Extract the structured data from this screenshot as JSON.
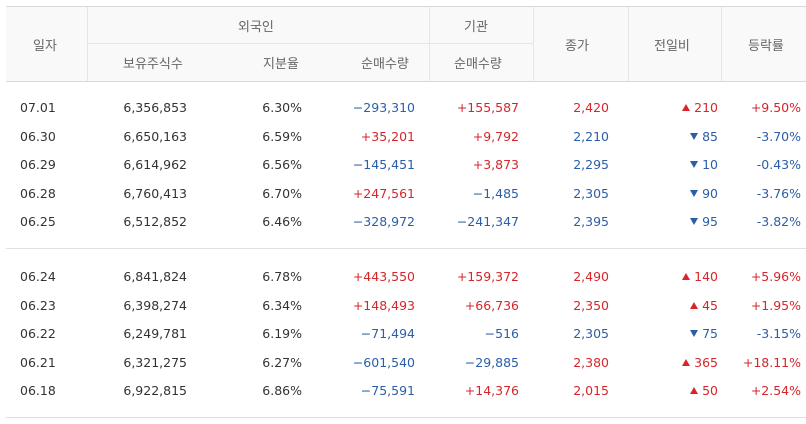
{
  "header": {
    "date": "일자",
    "foreign": "외국인",
    "institution": "기관",
    "close": "종가",
    "change": "전일비",
    "rate": "등락률",
    "holdings": "보유주식수",
    "share_ratio": "지분율",
    "foreign_net": "순매수량",
    "inst_net": "순매수량"
  },
  "colors": {
    "up": "#d6262b",
    "down": "#2b5ea8"
  },
  "groups": [
    {
      "rows": [
        {
          "date": "07.01",
          "holdings": "6,356,853",
          "ratio": "6.30%",
          "foreign_net": "−293,310",
          "fdir": "down",
          "inst_net": "+155,587",
          "idir": "up",
          "close": "2,420",
          "cdir": "up",
          "change": "210",
          "chdir": "up",
          "rate": "+9.50%",
          "rdir": "up"
        },
        {
          "date": "06.30",
          "holdings": "6,650,163",
          "ratio": "6.59%",
          "foreign_net": "+35,201",
          "fdir": "up",
          "inst_net": "+9,792",
          "idir": "up",
          "close": "2,210",
          "cdir": "down",
          "change": "85",
          "chdir": "down",
          "rate": "-3.70%",
          "rdir": "down"
        },
        {
          "date": "06.29",
          "holdings": "6,614,962",
          "ratio": "6.56%",
          "foreign_net": "−145,451",
          "fdir": "down",
          "inst_net": "+3,873",
          "idir": "up",
          "close": "2,295",
          "cdir": "down",
          "change": "10",
          "chdir": "down",
          "rate": "-0.43%",
          "rdir": "down"
        },
        {
          "date": "06.28",
          "holdings": "6,760,413",
          "ratio": "6.70%",
          "foreign_net": "+247,561",
          "fdir": "up",
          "inst_net": "−1,485",
          "idir": "down",
          "close": "2,305",
          "cdir": "down",
          "change": "90",
          "chdir": "down",
          "rate": "-3.76%",
          "rdir": "down"
        },
        {
          "date": "06.25",
          "holdings": "6,512,852",
          "ratio": "6.46%",
          "foreign_net": "−328,972",
          "fdir": "down",
          "inst_net": "−241,347",
          "idir": "down",
          "close": "2,395",
          "cdir": "down",
          "change": "95",
          "chdir": "down",
          "rate": "-3.82%",
          "rdir": "down"
        }
      ]
    },
    {
      "rows": [
        {
          "date": "06.24",
          "holdings": "6,841,824",
          "ratio": "6.78%",
          "foreign_net": "+443,550",
          "fdir": "up",
          "inst_net": "+159,372",
          "idir": "up",
          "close": "2,490",
          "cdir": "up",
          "change": "140",
          "chdir": "up",
          "rate": "+5.96%",
          "rdir": "up"
        },
        {
          "date": "06.23",
          "holdings": "6,398,274",
          "ratio": "6.34%",
          "foreign_net": "+148,493",
          "fdir": "up",
          "inst_net": "+66,736",
          "idir": "up",
          "close": "2,350",
          "cdir": "up",
          "change": "45",
          "chdir": "up",
          "rate": "+1.95%",
          "rdir": "up"
        },
        {
          "date": "06.22",
          "holdings": "6,249,781",
          "ratio": "6.19%",
          "foreign_net": "−71,494",
          "fdir": "down",
          "inst_net": "−516",
          "idir": "down",
          "close": "2,305",
          "cdir": "down",
          "change": "75",
          "chdir": "down",
          "rate": "-3.15%",
          "rdir": "down"
        },
        {
          "date": "06.21",
          "holdings": "6,321,275",
          "ratio": "6.27%",
          "foreign_net": "−601,540",
          "fdir": "down",
          "inst_net": "−29,885",
          "idir": "down",
          "close": "2,380",
          "cdir": "up",
          "change": "365",
          "chdir": "up",
          "rate": "+18.11%",
          "rdir": "up"
        },
        {
          "date": "06.18",
          "holdings": "6,922,815",
          "ratio": "6.86%",
          "foreign_net": "−75,591",
          "fdir": "down",
          "inst_net": "+14,376",
          "idir": "up",
          "close": "2,015",
          "cdir": "up",
          "change": "50",
          "chdir": "up",
          "rate": "+2.54%",
          "rdir": "up"
        }
      ]
    }
  ]
}
